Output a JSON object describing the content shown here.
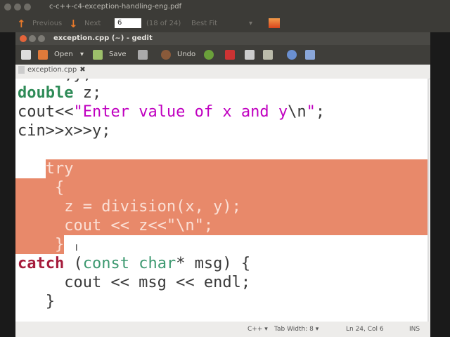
{
  "pdf": {
    "title": "c-c++-c4-exception-handling-eng.pdf",
    "previous": "Previous",
    "next": "Next",
    "page": "6",
    "page_count": "(18 of 24)",
    "zoom": "Best Fit",
    "dropdown": "▾"
  },
  "gedit": {
    "title": "exception.cpp (~) - gedit",
    "toolbar": {
      "open": "Open",
      "open_arrow": "▾",
      "save": "Save",
      "undo": "Undo"
    },
    "tab": {
      "label": "exception.cpp",
      "close": "✖"
    },
    "code": [
      [
        [
          "",
          "int x,y;"
        ]
      ],
      [
        [
          "ty",
          "double"
        ],
        [
          "",
          " z;"
        ]
      ],
      [
        [
          "",
          "cout<<"
        ],
        [
          "str",
          "\"Enter value of x and y"
        ],
        [
          "",
          "\\n"
        ],
        [
          "str",
          "\""
        ],
        [
          "",
          ";"
        ]
      ],
      [
        [
          "",
          "cin>>x>>y;"
        ]
      ],
      [
        [
          "",
          ""
        ]
      ],
      [
        [
          "",
          "   "
        ],
        [
          "insel",
          "try"
        ]
      ],
      [
        [
          "insel",
          "    {"
        ]
      ],
      [
        [
          "insel",
          "     z = division(x, y);"
        ]
      ],
      [
        [
          "insel",
          "     cout << z<<\"\\n\";"
        ]
      ],
      [
        [
          "insel",
          "    }"
        ]
      ],
      [
        [
          "kw",
          "catch"
        ],
        [
          "",
          " ("
        ],
        [
          "ty2",
          "const char"
        ],
        [
          "",
          "* msg) {"
        ]
      ],
      [
        [
          "",
          "     cout << msg << endl;"
        ]
      ],
      [
        [
          "",
          "   }"
        ]
      ]
    ],
    "status": {
      "language": "C++ ▾",
      "tab_width": "Tab Width: 8 ▾",
      "position": "Ln 24, Col 6",
      "mode": "INS"
    }
  },
  "colors": {
    "selection": "#e8896a",
    "accent": "#e8792a"
  }
}
